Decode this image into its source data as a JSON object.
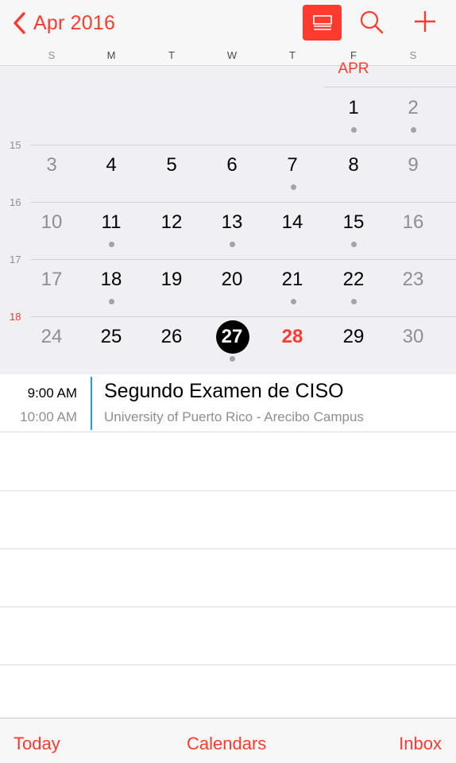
{
  "nav": {
    "back_label": "Apr 2016",
    "back_icon": "chevron-left-icon",
    "list_icon": "list-view-icon",
    "search_icon": "search-icon",
    "add_icon": "plus-icon"
  },
  "weekdays": [
    "S",
    "M",
    "T",
    "W",
    "T",
    "F",
    "S"
  ],
  "month_label": "APR",
  "week_numbers": [
    "15",
    "16",
    "17",
    "18"
  ],
  "weeks": [
    [
      "",
      "",
      "",
      "",
      "",
      "1",
      "2"
    ],
    [
      "3",
      "4",
      "5",
      "6",
      "7",
      "8",
      "9"
    ],
    [
      "10",
      "11",
      "12",
      "13",
      "14",
      "15",
      "16"
    ],
    [
      "17",
      "18",
      "19",
      "20",
      "21",
      "22",
      "23"
    ],
    [
      "24",
      "25",
      "26",
      "27",
      "28",
      "29",
      "30"
    ]
  ],
  "event_dots": [
    [
      false,
      false,
      false,
      false,
      false,
      true,
      true
    ],
    [
      false,
      false,
      false,
      false,
      true,
      false,
      false
    ],
    [
      false,
      true,
      false,
      true,
      false,
      true,
      false
    ],
    [
      false,
      true,
      false,
      false,
      true,
      true,
      false
    ],
    [
      false,
      false,
      false,
      true,
      false,
      false,
      false
    ]
  ],
  "selected_day": "27",
  "today": "28",
  "event": {
    "start": "9:00 AM",
    "end": "10:00 AM",
    "title": "Segundo Examen de CISO",
    "location": "University of Puerto Rico - Arecibo Campus"
  },
  "colors": {
    "accent": "#ff3b30",
    "event_bar": "#1a9fe0",
    "selected": "#000000"
  },
  "toolbar": {
    "today": "Today",
    "calendars": "Calendars",
    "inbox": "Inbox"
  }
}
